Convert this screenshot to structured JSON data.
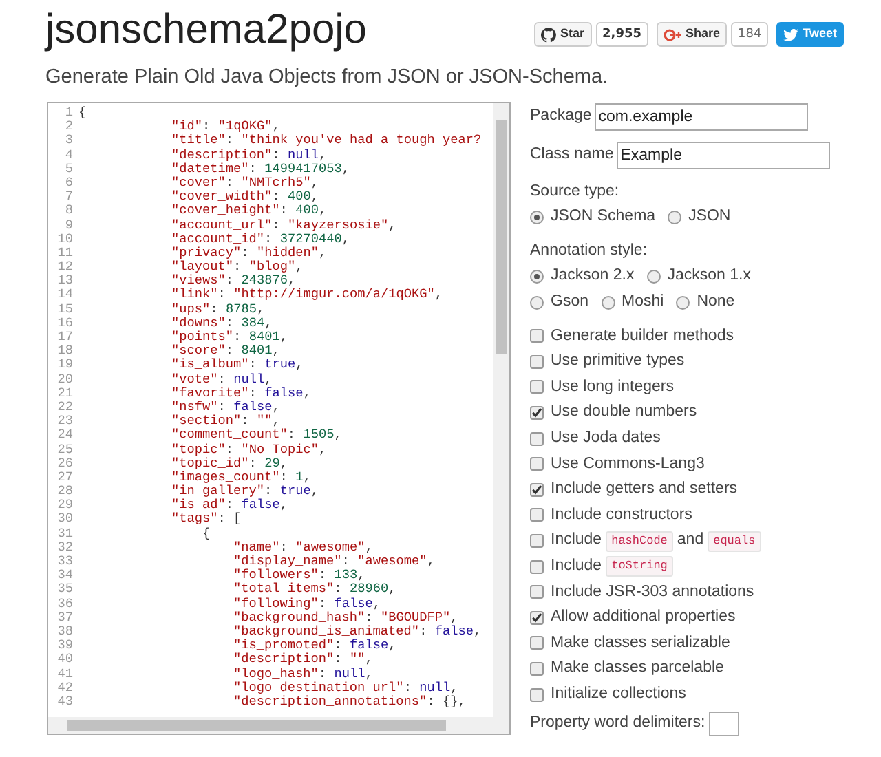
{
  "header": {
    "title": "jsonschema2pojo",
    "subtitle": "Generate Plain Old Java Objects from JSON or JSON-Schema."
  },
  "social": [
    {
      "kind": "github",
      "label": "Star",
      "count": "2,955"
    },
    {
      "kind": "gplus",
      "label": "Share",
      "count": "184"
    },
    {
      "kind": "twitter",
      "label": "Tweet"
    }
  ],
  "editor": {
    "lines": [
      {
        "number": "1",
        "text": "{"
      },
      {
        "number": "2",
        "text": "            \"id\": \"1qOKG\","
      },
      {
        "number": "3",
        "text": "            \"title\": \"think you've had a tough year?"
      },
      {
        "number": "4",
        "text": "            \"description\": null,"
      },
      {
        "number": "5",
        "text": "            \"datetime\": 1499417053,"
      },
      {
        "number": "6",
        "text": "            \"cover\": \"NMTcrh5\","
      },
      {
        "number": "7",
        "text": "            \"cover_width\": 400,"
      },
      {
        "number": "8",
        "text": "            \"cover_height\": 400,"
      },
      {
        "number": "9",
        "text": "            \"account_url\": \"kayzersosie\","
      },
      {
        "number": "10",
        "text": "            \"account_id\": 37270440,"
      },
      {
        "number": "11",
        "text": "            \"privacy\": \"hidden\","
      },
      {
        "number": "12",
        "text": "            \"layout\": \"blog\","
      },
      {
        "number": "13",
        "text": "            \"views\": 243876,"
      },
      {
        "number": "14",
        "text": "            \"link\": \"http://imgur.com/a/1qOKG\","
      },
      {
        "number": "15",
        "text": "            \"ups\": 8785,"
      },
      {
        "number": "16",
        "text": "            \"downs\": 384,"
      },
      {
        "number": "17",
        "text": "            \"points\": 8401,"
      },
      {
        "number": "18",
        "text": "            \"score\": 8401,"
      },
      {
        "number": "19",
        "text": "            \"is_album\": true,"
      },
      {
        "number": "20",
        "text": "            \"vote\": null,"
      },
      {
        "number": "21",
        "text": "            \"favorite\": false,"
      },
      {
        "number": "22",
        "text": "            \"nsfw\": false,"
      },
      {
        "number": "23",
        "text": "            \"section\": \"\","
      },
      {
        "number": "24",
        "text": "            \"comment_count\": 1505,"
      },
      {
        "number": "25",
        "text": "            \"topic\": \"No Topic\","
      },
      {
        "number": "26",
        "text": "            \"topic_id\": 29,"
      },
      {
        "number": "27",
        "text": "            \"images_count\": 1,"
      },
      {
        "number": "28",
        "text": "            \"in_gallery\": true,"
      },
      {
        "number": "29",
        "text": "            \"is_ad\": false,"
      },
      {
        "number": "30",
        "text": "            \"tags\": ["
      },
      {
        "number": "31",
        "text": "                {"
      },
      {
        "number": "32",
        "text": "                    \"name\": \"awesome\","
      },
      {
        "number": "33",
        "text": "                    \"display_name\": \"awesome\","
      },
      {
        "number": "34",
        "text": "                    \"followers\": 133,"
      },
      {
        "number": "35",
        "text": "                    \"total_items\": 28960,"
      },
      {
        "number": "36",
        "text": "                    \"following\": false,"
      },
      {
        "number": "37",
        "text": "                    \"background_hash\": \"BGOUDFP\","
      },
      {
        "number": "38",
        "text": "                    \"background_is_animated\": false,"
      },
      {
        "number": "39",
        "text": "                    \"is_promoted\": false,"
      },
      {
        "number": "40",
        "text": "                    \"description\": \"\","
      },
      {
        "number": "41",
        "text": "                    \"logo_hash\": null,"
      },
      {
        "number": "42",
        "text": "                    \"logo_destination_url\": null,"
      },
      {
        "number": "43",
        "text": "                    \"description_annotations\": {},"
      }
    ]
  },
  "fields": [
    {
      "label": "Package",
      "value": "com.example"
    },
    {
      "label": "Class name",
      "value": "Example"
    }
  ],
  "source_type": {
    "label": "Source type:",
    "options": [
      {
        "label": "JSON Schema",
        "selected": true
      },
      {
        "label": "JSON",
        "selected": false
      }
    ]
  },
  "annotation_style": {
    "label": "Annotation style:",
    "options": [
      {
        "label": "Jackson 2.x",
        "selected": true
      },
      {
        "label": "Jackson 1.x",
        "selected": false
      },
      {
        "label": "Gson",
        "selected": false
      },
      {
        "label": "Moshi",
        "selected": false
      },
      {
        "label": "None",
        "selected": false
      }
    ]
  },
  "options": [
    {
      "parts": [
        {
          "text": "Generate builder methods",
          "code": false
        }
      ],
      "checked": false
    },
    {
      "parts": [
        {
          "text": "Use primitive types",
          "code": false
        }
      ],
      "checked": false
    },
    {
      "parts": [
        {
          "text": "Use long integers",
          "code": false
        }
      ],
      "checked": false
    },
    {
      "parts": [
        {
          "text": "Use double numbers",
          "code": false
        }
      ],
      "checked": true
    },
    {
      "parts": [
        {
          "text": "Use Joda dates",
          "code": false
        }
      ],
      "checked": false
    },
    {
      "parts": [
        {
          "text": "Use Commons-Lang3",
          "code": false
        }
      ],
      "checked": false
    },
    {
      "parts": [
        {
          "text": "Include getters and setters",
          "code": false
        }
      ],
      "checked": true
    },
    {
      "parts": [
        {
          "text": "Include constructors",
          "code": false
        }
      ],
      "checked": false
    },
    {
      "parts": [
        {
          "text": "Include",
          "code": false
        },
        {
          "text": "hashCode",
          "code": true
        },
        {
          "text": "and",
          "code": false
        },
        {
          "text": "equals",
          "code": true
        }
      ],
      "checked": false
    },
    {
      "parts": [
        {
          "text": "Include",
          "code": false
        },
        {
          "text": "toString",
          "code": true
        }
      ],
      "checked": false
    },
    {
      "parts": [
        {
          "text": "Include JSR-303 annotations",
          "code": false
        }
      ],
      "checked": false
    },
    {
      "parts": [
        {
          "text": "Allow additional properties",
          "code": false
        }
      ],
      "checked": true
    },
    {
      "parts": [
        {
          "text": "Make classes serializable",
          "code": false
        }
      ],
      "checked": false
    },
    {
      "parts": [
        {
          "text": "Make classes parcelable",
          "code": false
        }
      ],
      "checked": false
    },
    {
      "parts": [
        {
          "text": "Initialize collections",
          "code": false
        }
      ],
      "checked": false
    }
  ],
  "delimiters": {
    "label": "Property word delimiters:"
  }
}
